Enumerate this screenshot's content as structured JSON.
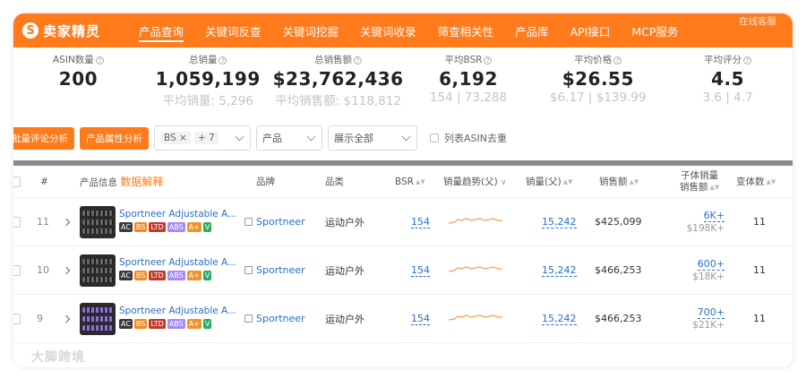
{
  "brand": {
    "name": "卖家精灵",
    "logo_letter": "S"
  },
  "nav": {
    "items": [
      "产品查询",
      "关键词反查",
      "关键词挖掘",
      "关键词收录",
      "筛查相关性",
      "产品库",
      "API接口",
      "MCP服务"
    ],
    "active": 0,
    "online_service": "在线客服"
  },
  "stats": [
    {
      "label": "ASIN数量",
      "value": "200",
      "sub": ""
    },
    {
      "label": "总销量",
      "value": "1,059,199",
      "sub": "平均销量: 5,296"
    },
    {
      "label": "总销售额",
      "value": "$23,762,436",
      "sub": "平均销售额: $118,812"
    },
    {
      "label": "平均BSR",
      "value": "6,192",
      "sub": "154 | 73,288"
    },
    {
      "label": "平均价格",
      "value": "$26.55",
      "sub": "$6.17 | $139.99"
    },
    {
      "label": "平均评分",
      "value": "4.5",
      "sub": "3.6 | 4.7"
    }
  ],
  "filters": {
    "btn_review": "批量评论分析",
    "btn_attr": "产品属性分析",
    "tag1": "BS",
    "tag_more": "+ 7",
    "product_select": "产品",
    "show_select": "展示全部",
    "dedupe_label": "列表ASIN去重"
  },
  "table": {
    "headers": {
      "index": "#",
      "product": "产品信息",
      "explain": "数据解释",
      "brand": "品牌",
      "category": "品类",
      "bsr": "BSR",
      "trend": "销量趋势(父)",
      "sales": "销量(父)",
      "revenue": "销售额",
      "child_sales_1": "子体销量",
      "child_sales_2": "销售额",
      "variants": "变体数"
    },
    "rows": [
      {
        "index": "11",
        "name": "Sportneer Adjustable A...",
        "brand": "Sportneer",
        "category": "运动户外",
        "bsr": "154",
        "sales": "15,242",
        "revenue": "$425,099",
        "child_sales": "6K+",
        "child_revenue": "$198K+",
        "variants": "11",
        "thumb": "dark"
      },
      {
        "index": "10",
        "name": "Sportneer Adjustable A...",
        "brand": "Sportneer",
        "category": "运动户外",
        "bsr": "154",
        "sales": "15,242",
        "revenue": "$466,253",
        "child_sales": "600+",
        "child_revenue": "$18K+",
        "variants": "11",
        "thumb": "dark"
      },
      {
        "index": "9",
        "name": "Sportneer Adjustable A...",
        "brand": "Sportneer",
        "category": "运动户外",
        "bsr": "154",
        "sales": "15,242",
        "revenue": "$466,253",
        "child_sales": "700+",
        "child_revenue": "$21K+",
        "variants": "11",
        "thumb": "purple"
      }
    ],
    "badges": [
      {
        "text": "AC",
        "color": "#3a3a3a"
      },
      {
        "text": "BS",
        "color": "#f08a24"
      },
      {
        "text": "LTD",
        "color": "#c0392b"
      },
      {
        "text": "ABS",
        "color": "#a78bfa"
      },
      {
        "text": "A+",
        "color": "#f0932b"
      },
      {
        "text": "V",
        "color": "#27ae60"
      }
    ]
  },
  "watermark": "大脚跨境",
  "colors": {
    "accent": "#ff7a1a",
    "link": "#2a6fc9"
  }
}
